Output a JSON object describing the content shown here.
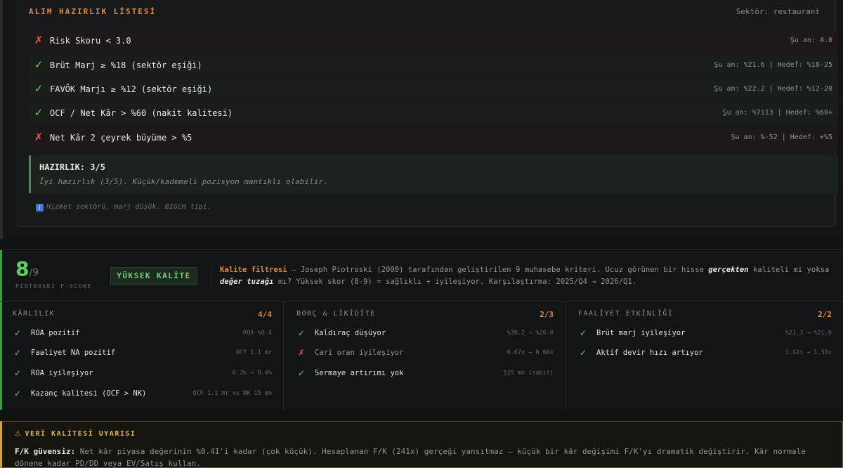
{
  "prep": {
    "title": "ALIM HAZIRLIK LİSTESİ",
    "sector": "Sektör: restaurant",
    "criteria": [
      {
        "status": "fail",
        "label": "Risk Skoru < 3.0",
        "current": "Şu an: 4.0"
      },
      {
        "status": "pass",
        "label": "Brüt Marj ≥ %18 (sektör eşiği)",
        "current": "Şu an: %21.6 | Hedef: %18-25"
      },
      {
        "status": "pass",
        "label": "FAVÖK Marjı ≥ %12 (sektör eşiği)",
        "current": "Şu an: %22.2 | Hedef: %12-20"
      },
      {
        "status": "pass",
        "label": "OCF / Net Kâr > %60 (nakit kalitesi)",
        "current": "Şu an: %7113 | Hedef: %60+"
      },
      {
        "status": "fail",
        "label": "Net Kâr 2 çeyrek büyüme > %5",
        "current": "Şu an: %-52 | Hedef: +%5"
      }
    ],
    "summary_title": "HAZIRLIK: 3/5",
    "summary_text": "İyi hazırlık (3/5). Küçük/kademeli pozisyon mantıklı olabilir.",
    "note": "Hizmet sektörü, marj düşük. BIGCH tipi.",
    "note_icon": "info-icon"
  },
  "piotroski": {
    "score": "8",
    "max": "/9",
    "subtitle": "PIOTROSKI F-SCORE",
    "badge": "YÜKSEK KALİTE",
    "desc_highlight": "Kalite filtresi",
    "desc_part1": " — Joseph Piotroski (2000) tarafından geliştirilen 9 muhasebe kriteri. Ucuz görünen bir hisse ",
    "desc_em1": "gerçekten",
    "desc_part2": " kaliteli mi yoksa ",
    "desc_em2": "değer tuzağı",
    "desc_part3": " mı? Yüksek skor (8-9) = sağlıklı + iyileşiyor. Karşılaştırma: 2025/Q4 → 2026/Q1.",
    "columns": [
      {
        "title": "KÂRLILIK",
        "score": "4/4",
        "items": [
          {
            "status": "pass",
            "label": "ROA pozitif",
            "value": "ROA %0.4"
          },
          {
            "status": "pass",
            "label": "Faaliyet NA pozitif",
            "value": "OCF 1.1 mr"
          },
          {
            "status": "pass",
            "label": "ROA iyileşiyor",
            "value": "0.3% → 0.4%"
          },
          {
            "status": "pass",
            "label": "Kazanç kalitesi (OCF > NK)",
            "value": "OCF 1.1 mr vs NK 15 mn"
          }
        ]
      },
      {
        "title": "BORÇ & LİKİDİTE",
        "score": "2/3",
        "items": [
          {
            "status": "pass",
            "label": "Kaldıraç düşüyor",
            "value": "%30.2 → %26.0"
          },
          {
            "status": "fail",
            "label": "Cari oran iyileşiyor",
            "value": "0.67x → 0.66x"
          },
          {
            "status": "pass",
            "label": "Sermaye artırımı yok",
            "value": "535 mn (sabit)"
          }
        ]
      },
      {
        "title": "FAALİYET ETKİNLİĞİ",
        "score": "2/2",
        "items": [
          {
            "status": "pass",
            "label": "Brüt marj iyileşiyor",
            "value": "%21.3 → %21.6"
          },
          {
            "status": "pass",
            "label": "Aktif devir hızı artıyor",
            "value": "1.42x → 1.50x"
          }
        ]
      }
    ]
  },
  "warning": {
    "icon": "warning-icon",
    "title": "VERİ KALİTESİ UYARISI",
    "lead": "F/K güvensiz:",
    "text": " Net kâr piyasa değerinin %0.41'i kadar (çok küçük). Hesaplanan F/K (241x) gerçeği yansıtmaz — küçük bir kâr değişimi F/K'yı dramatik değiştirir. Kâr normale dönene kadar PD/DD veya EV/Satış kullan."
  },
  "colors": {
    "accent_orange": "#e08a3c",
    "pass_green": "#5fcf6a",
    "fail_red": "#d9534f",
    "warn_yellow": "#e0b84a"
  }
}
